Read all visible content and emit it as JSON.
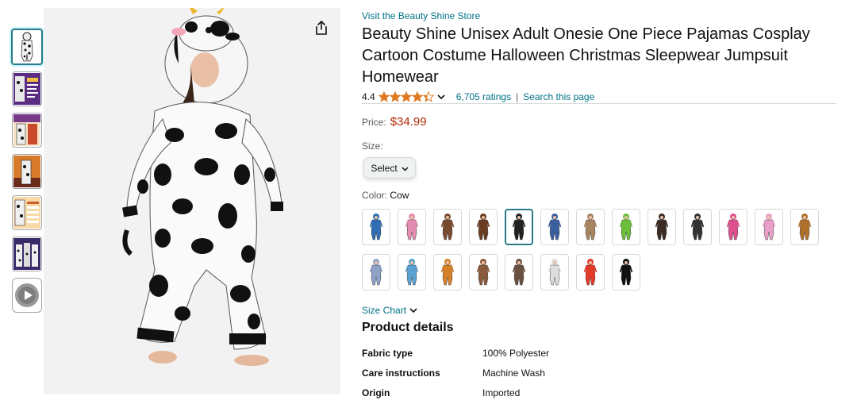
{
  "store": {
    "link_text": "Visit the Beauty Shine Store"
  },
  "product": {
    "title": "Beauty Shine Unisex Adult Onesie One Piece Pajamas Cosplay Cartoon Costume Halloween Christmas Sleepwear Jumpsuit Homewear"
  },
  "rating": {
    "value": "4.4",
    "stars": 4.4,
    "ratings_text": "6,705 ratings",
    "separator": "|",
    "search_text": "Search this page"
  },
  "price": {
    "label": "Price:",
    "value": "$34.99"
  },
  "size": {
    "label": "Size:",
    "select_value": "Select"
  },
  "color": {
    "label": "Color:",
    "value": "Cow"
  },
  "swatches": [
    {
      "color": "#2f6db5",
      "selected": false
    },
    {
      "color": "#e48bb0",
      "selected": false
    },
    {
      "color": "#7a4a30",
      "selected": false
    },
    {
      "color": "#6b3b22",
      "selected": false
    },
    {
      "color": "#222222",
      "selected": true
    },
    {
      "color": "#3a5fa0",
      "selected": false
    },
    {
      "color": "#a88560",
      "selected": false
    },
    {
      "color": "#6cbf3a",
      "selected": false
    },
    {
      "color": "#3b2b22",
      "selected": false
    },
    {
      "color": "#333333",
      "selected": false
    },
    {
      "color": "#e0508e",
      "selected": false
    },
    {
      "color": "#e9a0c8",
      "selected": false
    },
    {
      "color": "#b0702a",
      "selected": false
    },
    {
      "color": "#8fa3c8",
      "selected": false
    },
    {
      "color": "#5aa0d0",
      "selected": false
    },
    {
      "color": "#d6802a",
      "selected": false
    },
    {
      "color": "#8a5a3a",
      "selected": false
    },
    {
      "color": "#6a5040",
      "selected": false
    },
    {
      "color": "#dddddd",
      "selected": false
    },
    {
      "color": "#e53a2a",
      "selected": false
    },
    {
      "color": "#111111",
      "selected": false
    }
  ],
  "size_chart": {
    "label": "Size Chart"
  },
  "details": {
    "heading": "Product details",
    "rows": [
      {
        "key": "Fabric type",
        "value": "100% Polyester"
      },
      {
        "key": "Care instructions",
        "value": "Machine Wash"
      },
      {
        "key": "Origin",
        "value": "Imported"
      }
    ]
  },
  "colors": {
    "link": "#007185",
    "price": "#b12704",
    "star": "#de7921",
    "selected_border": "#2a7b86"
  },
  "icons": {
    "share": "share-icon",
    "chevron": "chevron-down-icon",
    "star": "star-icon",
    "video": "video-play-icon"
  },
  "thumbnails": [
    {
      "type": "image",
      "selected": true
    },
    {
      "type": "image",
      "selected": false
    },
    {
      "type": "image",
      "selected": false
    },
    {
      "type": "image",
      "selected": false
    },
    {
      "type": "image",
      "selected": false
    },
    {
      "type": "image",
      "selected": false
    },
    {
      "type": "video",
      "selected": false
    }
  ]
}
